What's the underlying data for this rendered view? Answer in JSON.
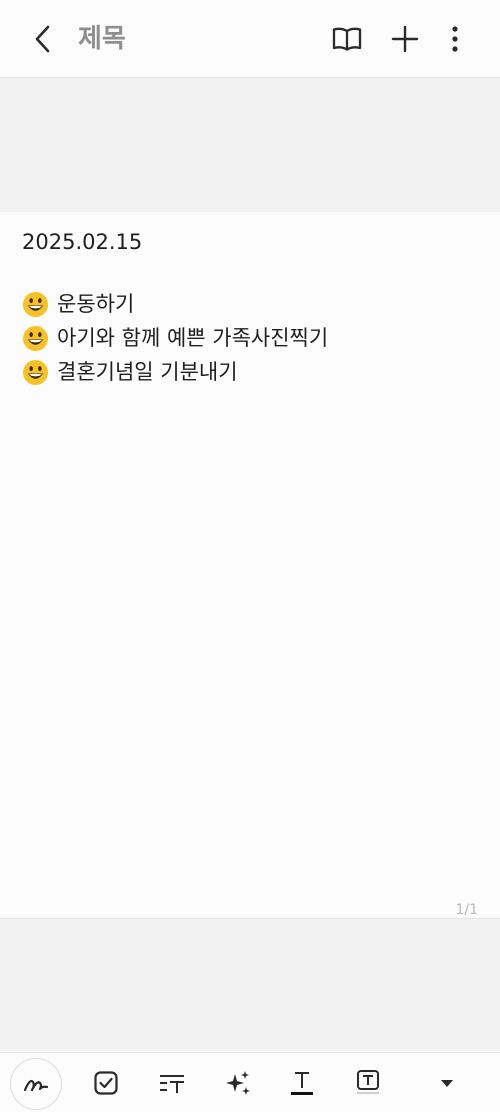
{
  "header": {
    "title": "제목",
    "icons": [
      "back-icon",
      "book-icon",
      "plus-icon",
      "more-vertical-icon"
    ]
  },
  "note": {
    "date": "2025.02.15",
    "items": [
      {
        "emoji": "grinning-face",
        "text": "운동하기"
      },
      {
        "emoji": "grinning-face",
        "text": "아기와 함께 예쁜 가족사진찍기"
      },
      {
        "emoji": "grinning-face",
        "text": "결혼기념일 기분내기"
      }
    ],
    "page_indicator": "1/1"
  },
  "toolbar": {
    "tools": [
      "pen-icon",
      "checkbox-icon",
      "text-style-icon",
      "sparkle-icon",
      "font-color-icon",
      "text-box-icon",
      "expand-down-icon"
    ]
  },
  "colors": {
    "background": "#f2f2f2",
    "surface": "#fcfcfc",
    "text": "#1f1f1f",
    "title_gray": "#8e8e8e",
    "emoji_yellow": "#f7c12a"
  }
}
